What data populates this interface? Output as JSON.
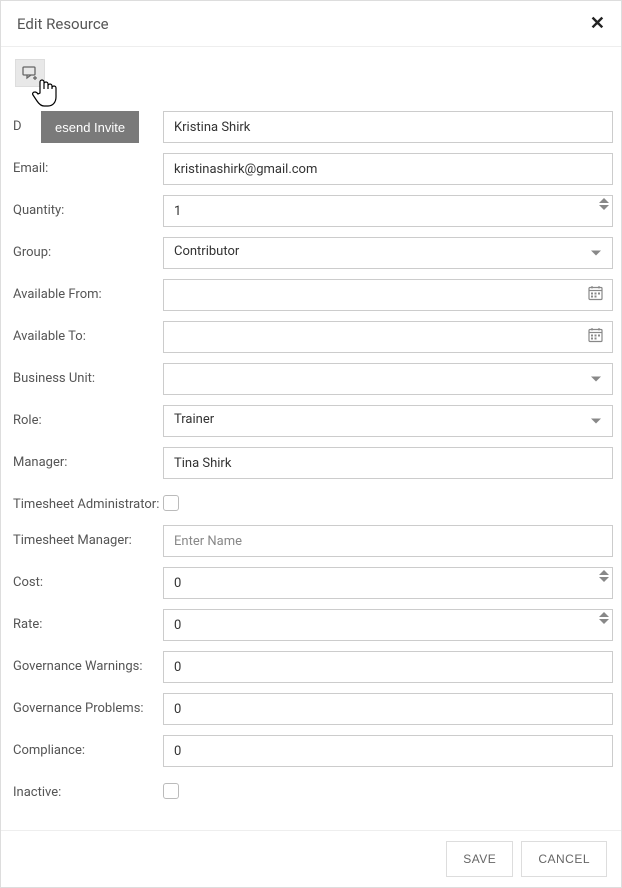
{
  "modal": {
    "title": "Edit Resource"
  },
  "fields": {
    "display_name_label": "D",
    "display_name_value": "Kristina Shirk",
    "resend_invite_label": "esend Invite",
    "email_label": "Email:",
    "email_value": "kristinashirk@gmail.com",
    "quantity_label": "Quantity:",
    "quantity_value": "1",
    "group_label": "Group:",
    "group_value": "Contributor",
    "available_from_label": "Available From:",
    "available_from_value": "",
    "available_to_label": "Available To:",
    "available_to_value": "",
    "business_unit_label": "Business Unit:",
    "business_unit_value": "",
    "role_label": "Role:",
    "role_value": "Trainer",
    "manager_label": "Manager:",
    "manager_value": "Tina Shirk",
    "timesheet_admin_label": "Timesheet Administrator:",
    "timesheet_admin_checked": false,
    "timesheet_manager_label": "Timesheet Manager:",
    "timesheet_manager_placeholder": "Enter Name",
    "timesheet_manager_value": "",
    "cost_label": "Cost:",
    "cost_value": "0",
    "rate_label": "Rate:",
    "rate_value": "0",
    "gov_warnings_label": "Governance Warnings:",
    "gov_warnings_value": "0",
    "gov_problems_label": "Governance Problems:",
    "gov_problems_value": "0",
    "compliance_label": "Compliance:",
    "compliance_value": "0",
    "inactive_label": "Inactive:",
    "inactive_checked": false
  },
  "footer": {
    "save_label": "SAVE",
    "cancel_label": "CANCEL"
  }
}
